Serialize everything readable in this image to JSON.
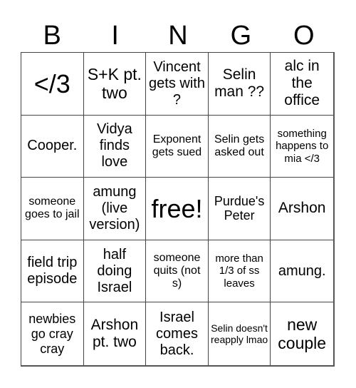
{
  "header": [
    "B",
    "I",
    "N",
    "G",
    "O"
  ],
  "cells": [
    "</3",
    "S+K pt. two",
    "Vincent gets with ?",
    "Selin man ??",
    "alc in the office",
    "Cooper.",
    "Vidya finds love",
    "Exponent gets sued",
    "Selin gets asked out",
    "something happens to mia </3",
    "someone goes to jail",
    "amung (live version)",
    "free!",
    "Purdue's Peter",
    "Arshon",
    "field trip episode",
    "half doing Israel",
    "someone quits (not s)",
    "more than 1/3 of ss leaves",
    "amung.",
    "newbies go cray cray",
    "Arshon pt. two",
    "Israel comes back.",
    "Selin doesn't reapply lmao",
    "new couple"
  ]
}
